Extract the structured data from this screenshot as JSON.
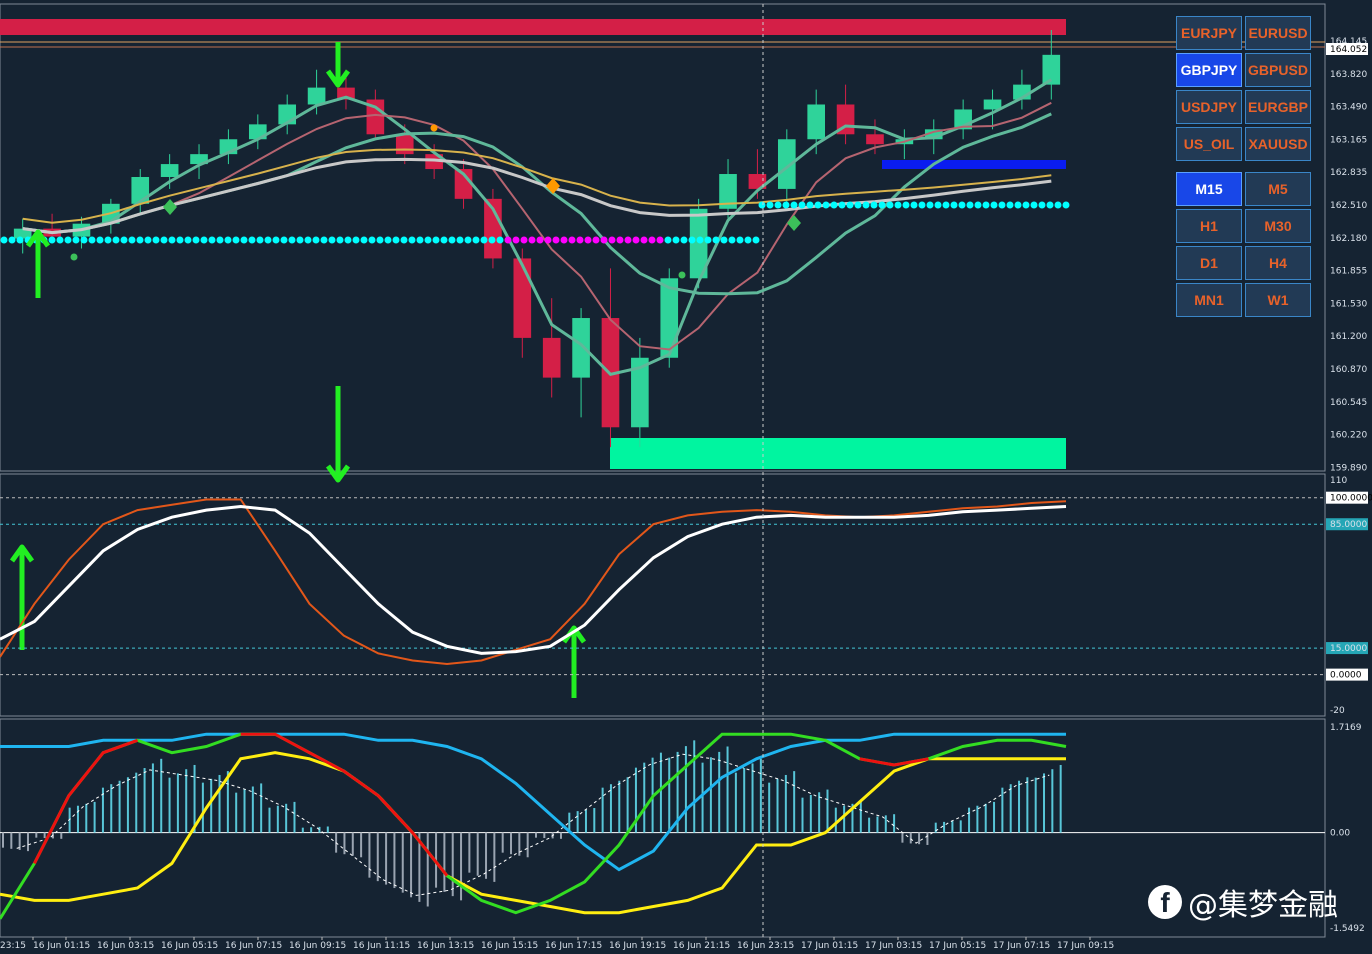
{
  "symbol_buttons": [
    {
      "label": "EURJPY",
      "active": false
    },
    {
      "label": "EURUSD",
      "active": false
    },
    {
      "label": "GBPJPY",
      "active": true
    },
    {
      "label": "GBPUSD",
      "active": false
    },
    {
      "label": "USDJPY",
      "active": false
    },
    {
      "label": "EURGBP",
      "active": false
    },
    {
      "label": "US_OIL",
      "active": false
    },
    {
      "label": "XAUUSD",
      "active": false
    }
  ],
  "timeframe_buttons": [
    {
      "label": "M15",
      "active": true
    },
    {
      "label": "M5",
      "active": false
    },
    {
      "label": "H1",
      "active": false
    },
    {
      "label": "M30",
      "active": false
    },
    {
      "label": "D1",
      "active": false
    },
    {
      "label": "H4",
      "active": false
    },
    {
      "label": "MN1",
      "active": false
    },
    {
      "label": "W1",
      "active": false
    }
  ],
  "watermark": {
    "icon": "facebook-icon",
    "text": "@集梦金融"
  },
  "colors": {
    "background": "#152332",
    "bull": "#2fd39a",
    "bear": "#d41f47",
    "ma_fast": "#5fb89a",
    "ma_slow": "#c8c8c8",
    "ma_gold": "#d7b24c",
    "ma_red": "#b56470",
    "dots_cyan": "#00ffff",
    "dots_magenta": "#ff00ff",
    "signal_arrow": "#22ee22",
    "stoch_white": "#ffffff",
    "stoch_orange": "#e2571a",
    "hist_gray": "#9aa4b1",
    "hist_cyan": "#58c6d8",
    "line_blue": "#1fb5f0",
    "line_yellow": "#ffee11",
    "line_red": "#ee1111",
    "line_green": "#33dd22"
  },
  "chart_data": [
    {
      "type": "candlestick",
      "symbol": "GBPJPY",
      "timeframe": "M15",
      "current_price": "164.052",
      "y_ticks": [
        "164.145",
        "163.820",
        "163.490",
        "163.165",
        "162.835",
        "162.510",
        "162.180",
        "161.855",
        "161.530",
        "161.200",
        "160.870",
        "160.545",
        "160.220",
        "159.890"
      ],
      "y_range": [
        159.89,
        164.3
      ],
      "ohlc": [
        [
          162.2,
          162.4,
          162.05,
          162.3
        ],
        [
          162.3,
          162.45,
          162.15,
          162.22
        ],
        [
          162.22,
          162.42,
          162.1,
          162.35
        ],
        [
          162.35,
          162.6,
          162.25,
          162.55
        ],
        [
          162.55,
          162.9,
          162.45,
          162.82
        ],
        [
          162.82,
          163.05,
          162.7,
          162.95
        ],
        [
          162.95,
          163.15,
          162.8,
          163.05
        ],
        [
          163.05,
          163.3,
          162.95,
          163.2
        ],
        [
          163.2,
          163.45,
          163.1,
          163.35
        ],
        [
          163.35,
          163.65,
          163.25,
          163.55
        ],
        [
          163.55,
          163.9,
          163.45,
          163.72
        ],
        [
          163.72,
          163.9,
          163.5,
          163.6
        ],
        [
          163.6,
          163.7,
          163.2,
          163.25
        ],
        [
          163.25,
          163.35,
          162.95,
          163.05
        ],
        [
          163.05,
          163.15,
          162.8,
          162.9
        ],
        [
          162.9,
          163.0,
          162.5,
          162.6
        ],
        [
          162.6,
          162.7,
          161.9,
          162.0
        ],
        [
          162.0,
          162.1,
          161.0,
          161.2
        ],
        [
          161.2,
          161.6,
          160.6,
          160.8
        ],
        [
          160.8,
          161.5,
          160.4,
          161.4
        ],
        [
          161.4,
          161.9,
          160.1,
          160.3
        ],
        [
          160.3,
          161.2,
          160.1,
          161.0
        ],
        [
          161.0,
          161.9,
          160.9,
          161.8
        ],
        [
          161.8,
          162.6,
          161.7,
          162.5
        ],
        [
          162.5,
          163.0,
          162.4,
          162.85
        ],
        [
          162.85,
          163.1,
          162.6,
          162.7
        ],
        [
          162.7,
          163.3,
          162.55,
          163.2
        ],
        [
          163.2,
          163.7,
          163.05,
          163.55
        ],
        [
          163.55,
          163.75,
          163.15,
          163.25
        ],
        [
          163.25,
          163.4,
          163.05,
          163.15
        ],
        [
          163.15,
          163.3,
          163.0,
          163.2
        ],
        [
          163.2,
          163.4,
          163.05,
          163.3
        ],
        [
          163.3,
          163.6,
          163.2,
          163.5
        ],
        [
          163.5,
          163.7,
          163.3,
          163.6
        ],
        [
          163.6,
          163.9,
          163.5,
          163.75
        ],
        [
          163.75,
          164.3,
          163.6,
          164.05
        ]
      ]
    },
    {
      "type": "line",
      "name": "stochastic",
      "y_ticks": [
        "110",
        "100.0000",
        "85.0000",
        "15.0000",
        "0.0000",
        "-20"
      ],
      "levels": [
        100,
        85,
        15,
        0
      ],
      "y_range": [
        -20,
        110
      ],
      "series": [
        {
          "color": "stoch_orange",
          "values": [
            10,
            40,
            65,
            85,
            93,
            96,
            99,
            99,
            70,
            40,
            22,
            12,
            8,
            6,
            8,
            14,
            20,
            40,
            68,
            85,
            90,
            92,
            93,
            92,
            90,
            89,
            90,
            92,
            94,
            95,
            97,
            98
          ]
        },
        {
          "color": "stoch_white",
          "values": [
            20,
            30,
            50,
            70,
            82,
            89,
            93,
            95,
            93,
            80,
            60,
            40,
            24,
            16,
            12,
            13,
            16,
            28,
            48,
            66,
            78,
            85,
            89,
            90,
            89,
            89,
            89,
            90,
            92,
            93,
            94,
            95
          ]
        }
      ]
    },
    {
      "type": "bar+line",
      "name": "oscillator",
      "y_ticks": [
        "1.7169",
        "0.00",
        "-1.5492"
      ],
      "y_range": [
        -1.5492,
        1.7169
      ],
      "histogram": [
        -0.3,
        -0.1,
        0.5,
        0.9,
        1.2,
        1.1,
        1.0,
        0.8,
        0.5,
        0.1,
        -0.4,
        -0.9,
        -1.2,
        -1.1,
        -0.8,
        -0.4,
        -0.1,
        0.4,
        0.9,
        1.3,
        1.5,
        1.4,
        1.2,
        1.0,
        0.7,
        0.5,
        0.3,
        -0.2,
        0.2,
        0.5,
        0.9,
        1.1
      ],
      "series": [
        {
          "color": "line_blue",
          "values": [
            1.4,
            1.4,
            1.4,
            1.5,
            1.5,
            1.5,
            1.6,
            1.6,
            1.6,
            1.6,
            1.6,
            1.5,
            1.5,
            1.4,
            1.2,
            0.8,
            0.3,
            -0.2,
            -0.6,
            -0.3,
            0.4,
            0.9,
            1.2,
            1.4,
            1.5,
            1.5,
            1.6,
            1.6,
            1.6,
            1.6,
            1.6,
            1.6
          ]
        },
        {
          "color": "line_yellow",
          "values": [
            -1.0,
            -1.1,
            -1.1,
            -1.0,
            -0.9,
            -0.5,
            0.4,
            1.2,
            1.3,
            1.2,
            1.0,
            0.6,
            0.0,
            -0.7,
            -1.0,
            -1.1,
            -1.2,
            -1.3,
            -1.3,
            -1.2,
            -1.1,
            -0.9,
            -0.2,
            -0.2,
            0.0,
            0.5,
            1.0,
            1.2,
            1.2,
            1.2,
            1.2,
            1.2
          ]
        },
        {
          "color": "line_green",
          "values": [
            -1.4,
            -0.5,
            0.6,
            1.3,
            1.5,
            1.3,
            1.4,
            1.6,
            1.6,
            1.3,
            1.0,
            0.6,
            0.0,
            -0.7,
            -1.1,
            -1.3,
            -1.1,
            -0.8,
            -0.2,
            0.6,
            1.1,
            1.6,
            1.6,
            1.6,
            1.5,
            1.2,
            1.1,
            1.2,
            1.4,
            1.5,
            1.5,
            1.4
          ]
        }
      ]
    }
  ],
  "time_labels": [
    "23:15",
    "16 Jun 01:15",
    "16 Jun 03:15",
    "16 Jun 05:15",
    "16 Jun 07:15",
    "16 Jun 09:15",
    "16 Jun 11:15",
    "16 Jun 13:15",
    "16 Jun 15:15",
    "16 Jun 17:15",
    "16 Jun 19:15",
    "16 Jun 21:15",
    "16 Jun 23:15",
    "17 Jun 01:15",
    "17 Jun 03:15",
    "17 Jun 05:15",
    "17 Jun 07:15",
    "17 Jun 09:15"
  ]
}
